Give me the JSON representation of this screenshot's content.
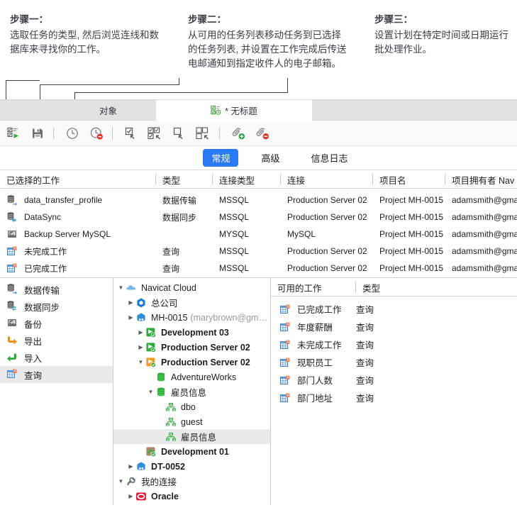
{
  "steps": [
    {
      "title": "步骤一：",
      "body": "选取任务的类型, 然后浏览连线和数据库来寻找你的工作。"
    },
    {
      "title": "步骤二：",
      "body": "从可用的任务列表移动任务到已选择的任务列表, 并设置在工作完成后传送电邮通知到指定收件人的电子邮箱。"
    },
    {
      "title": "步骤三：",
      "body": "设置计划在特定时间或日期运行批处理作业。"
    }
  ],
  "tabs": {
    "objects": "对象",
    "untitled": "* 无标题"
  },
  "toolbar": {
    "items": [
      {
        "name": "run-batch-job-icon",
        "label": "运行"
      },
      {
        "name": "save-icon",
        "label": "保存"
      },
      {
        "name": "schedule-icon",
        "label": "设置计划"
      },
      {
        "name": "delete-schedule-icon",
        "label": "删除计划"
      },
      {
        "name": "add-one-job-icon",
        "label": "加入工作"
      },
      {
        "name": "add-all-jobs-icon",
        "label": "加入全部工作"
      },
      {
        "name": "remove-one-job-icon",
        "label": "移除工作"
      },
      {
        "name": "remove-all-jobs-icon",
        "label": "移除全部工作"
      },
      {
        "name": "attach-add-icon",
        "label": "加入附件"
      },
      {
        "name": "attach-remove-icon",
        "label": "移除附件"
      }
    ]
  },
  "subtabs": [
    {
      "label": "常规",
      "active": true
    },
    {
      "label": "高级",
      "active": false
    },
    {
      "label": "信息日志",
      "active": false
    }
  ],
  "selected_jobs": {
    "columns": [
      "已选择的工作",
      "类型",
      "连接类型",
      "连接",
      "项目名",
      "项目拥有者 Nav"
    ],
    "rows": [
      {
        "icon": "data-transfer-icon",
        "name": "data_transfer_profile",
        "type": "数据传输",
        "conn_type": "MSSQL",
        "conn": "Production Server 02",
        "project": "Project MH-0015",
        "owner": "adamsmith@gma"
      },
      {
        "icon": "data-sync-icon",
        "name": "DataSync",
        "type": "数据同步",
        "conn_type": "MSSQL",
        "conn": "Production Server 02",
        "project": "Project MH-0015",
        "owner": "adamsmith@gma"
      },
      {
        "icon": "backup-icon",
        "name": "Backup Server MySQL",
        "type": "",
        "conn_type": "MYSQL",
        "conn": "MySQL",
        "project": "Project MH-0015",
        "owner": "adamsmith@gma"
      },
      {
        "icon": "query-icon",
        "name": "未完成工作",
        "type": "查询",
        "conn_type": "MSSQL",
        "conn": "Production Server 02",
        "project": "Project MH-0015",
        "owner": "adamsmith@gma"
      },
      {
        "icon": "query-icon",
        "name": "已完成工作",
        "type": "查询",
        "conn_type": "MSSQL",
        "conn": "Production Server 02",
        "project": "Project MH-0015",
        "owner": "adamsmith@gma"
      }
    ]
  },
  "type_list": [
    {
      "icon": "data-transfer-icon",
      "label": "数据传输",
      "selected": false
    },
    {
      "icon": "data-sync-icon",
      "label": "数据同步",
      "selected": false
    },
    {
      "icon": "backup-icon",
      "label": "备份",
      "selected": false
    },
    {
      "icon": "export-icon",
      "label": "导出",
      "selected": false
    },
    {
      "icon": "import-icon",
      "label": "导入",
      "selected": false
    },
    {
      "icon": "query-icon",
      "label": "查询",
      "selected": true
    }
  ],
  "tree": [
    {
      "indent": 0,
      "arrow": "down",
      "icon": "cloud-icon",
      "label": "Navicat Cloud",
      "bold": false,
      "selected": false,
      "dim": ""
    },
    {
      "indent": 1,
      "arrow": "right",
      "icon": "project-blue-icon",
      "label": "总公司",
      "bold": false,
      "selected": false,
      "dim": ""
    },
    {
      "indent": 1,
      "arrow": "right",
      "icon": "project-shared-icon",
      "label": "MH-0015",
      "bold": false,
      "selected": false,
      "dim": "(marybrown@gm…"
    },
    {
      "indent": 2,
      "arrow": "right",
      "icon": "conn-green-icon",
      "label": "Development 03",
      "bold": true,
      "selected": false,
      "dim": ""
    },
    {
      "indent": 2,
      "arrow": "right",
      "icon": "conn-green-icon",
      "label": "Production Server 02",
      "bold": true,
      "selected": false,
      "dim": ""
    },
    {
      "indent": 2,
      "arrow": "down",
      "icon": "conn-orange-icon",
      "label": "Production Server 02",
      "bold": true,
      "selected": false,
      "dim": ""
    },
    {
      "indent": 3,
      "arrow": "none",
      "icon": "database-icon",
      "label": "AdventureWorks",
      "bold": false,
      "selected": false,
      "dim": ""
    },
    {
      "indent": 3,
      "arrow": "down",
      "icon": "database-icon",
      "label": "雇员信息",
      "bold": false,
      "selected": false,
      "dim": ""
    },
    {
      "indent": 4,
      "arrow": "none",
      "icon": "schema-icon",
      "label": "dbo",
      "bold": false,
      "selected": false,
      "dim": ""
    },
    {
      "indent": 4,
      "arrow": "none",
      "icon": "schema-icon",
      "label": "guest",
      "bold": false,
      "selected": false,
      "dim": ""
    },
    {
      "indent": 4,
      "arrow": "none",
      "icon": "schema-icon",
      "label": "雇员信息",
      "bold": false,
      "selected": true,
      "dim": ""
    },
    {
      "indent": 2,
      "arrow": "none",
      "icon": "conn-brown-icon",
      "label": "Development 01",
      "bold": false,
      "selected": false,
      "dim": ""
    },
    {
      "indent": 1,
      "arrow": "right",
      "icon": "project-shared-icon",
      "label": "DT-0052",
      "bold": false,
      "selected": false,
      "dim": ""
    },
    {
      "indent": 0,
      "arrow": "down",
      "icon": "my-connections-icon",
      "label": "我的连接",
      "bold": false,
      "selected": false,
      "dim": ""
    },
    {
      "indent": 1,
      "arrow": "right",
      "icon": "oracle-icon",
      "label": "Oracle",
      "bold": true,
      "selected": false,
      "dim": ""
    }
  ],
  "available_jobs": {
    "columns": [
      "可用的工作",
      "类型"
    ],
    "rows": [
      {
        "icon": "query-icon",
        "name": "已完成工作",
        "type": "查询"
      },
      {
        "icon": "query-icon",
        "name": "年度薪酬",
        "type": "查询"
      },
      {
        "icon": "query-icon",
        "name": "未完成工作",
        "type": "查询"
      },
      {
        "icon": "query-icon",
        "name": "现职员工",
        "type": "查询"
      },
      {
        "icon": "query-icon",
        "name": "部门人数",
        "type": "查询"
      },
      {
        "icon": "query-icon",
        "name": "部门地址",
        "type": "查询"
      }
    ]
  },
  "colors": {
    "accent": "#2979f2",
    "tabbar": "#e2e2e2",
    "selection": "#eaeaea",
    "callout": "#3e444c"
  }
}
